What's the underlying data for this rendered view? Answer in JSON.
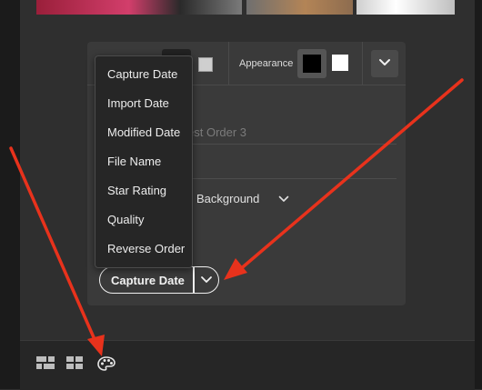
{
  "panel": {
    "appearance_label": "Appearance",
    "field_placeholder": "est Order 3",
    "background_label": "Background"
  },
  "sort_menu": {
    "items": [
      "Capture Date",
      "Import Date",
      "Modified Date",
      "File Name",
      "Star Rating",
      "Quality",
      "Reverse Order"
    ]
  },
  "sort_control": {
    "selected": "Capture Date"
  },
  "colors": {
    "annotation_arrow": "#e8321c",
    "panel_bg": "#3a3a3a",
    "menu_bg": "#262626"
  },
  "icons": {
    "toolbar_expand": "chevron-down-icon",
    "background_dropdown": "chevron-down-icon",
    "sort_dropdown": "chevron-down-icon",
    "bottom_bar": [
      "grid-layout-icon",
      "square-grid-icon",
      "palette-icon"
    ]
  }
}
